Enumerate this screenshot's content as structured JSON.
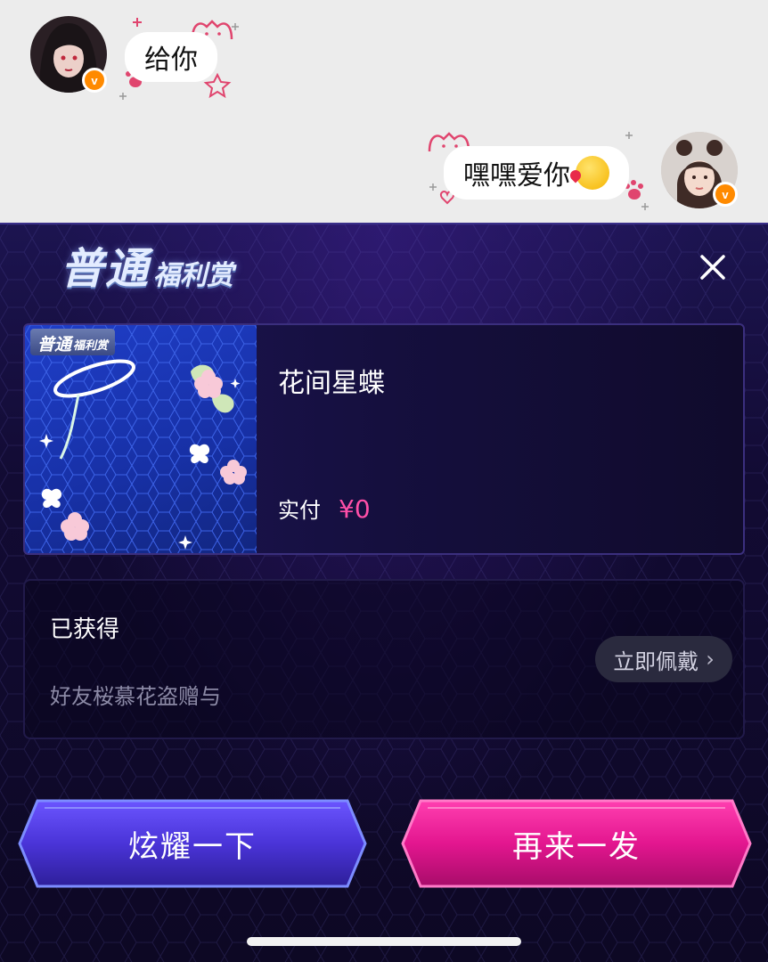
{
  "chat": {
    "messages": [
      {
        "side": "left",
        "text": "给你",
        "avatar": "avatar-female-dark-hair",
        "badge": "v"
      },
      {
        "side": "right",
        "text": "嘿嘿爱你",
        "emoji": "kiss-emoji",
        "avatar": "avatar-female-buns",
        "badge": "v"
      }
    ],
    "bubble_decoration": "cat-paw-stars",
    "accent_pink": "#e0456e"
  },
  "sheet": {
    "title_main": "普通",
    "title_sub": "福利赏",
    "close_icon": "close-icon",
    "prize": {
      "thumb_badge_main": "普通",
      "thumb_badge_sub": "福利赏",
      "name": "花间星蝶",
      "price_label": "实付",
      "price_value": "¥0"
    },
    "obtained": {
      "title": "已获得",
      "from": "好友桜慕花盗赠与",
      "wear_button": "立即佩戴"
    },
    "buttons": {
      "show_off": "炫耀一下",
      "again": "再来一发"
    }
  },
  "colors": {
    "sheet_bg": "#120b33",
    "price": "#ff4fa8",
    "button_left": "#4b35d6",
    "button_right": "#e3168f"
  }
}
